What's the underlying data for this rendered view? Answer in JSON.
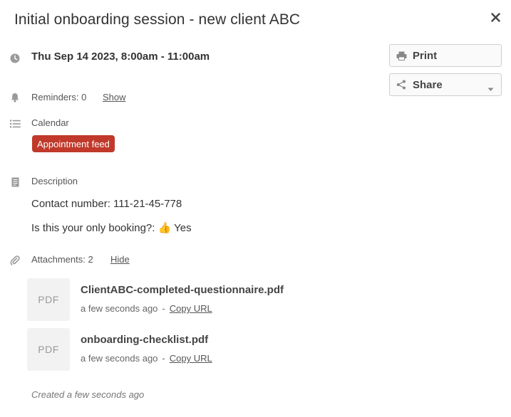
{
  "header": {
    "title": "Initial onboarding session - new client ABC",
    "close_icon": "close-icon"
  },
  "event": {
    "datetime": "Thu Sep 14 2023, 8:00am - 11:00am"
  },
  "actions": {
    "print_label": "Print",
    "share_label": "Share"
  },
  "reminders": {
    "label": "Reminders: 0",
    "show_link": "Show"
  },
  "calendar": {
    "label": "Calendar",
    "badge": "Appointment feed",
    "badge_color": "#c0392b"
  },
  "description": {
    "label": "Description",
    "lines": [
      "Contact number: 111-21-45-778",
      "Is this your only booking?: 👍 Yes"
    ]
  },
  "attachments": {
    "label": "Attachments: 2",
    "hide_link": "Hide",
    "items": [
      {
        "type": "PDF",
        "name": "ClientABC-completed-questionnaire.pdf",
        "time": "a few seconds ago",
        "separator": "-",
        "copy_label": "Copy URL"
      },
      {
        "type": "PDF",
        "name": "onboarding-checklist.pdf",
        "time": "a few seconds ago",
        "separator": "-",
        "copy_label": "Copy URL"
      }
    ]
  },
  "footer": {
    "created": "Created a few seconds ago"
  }
}
